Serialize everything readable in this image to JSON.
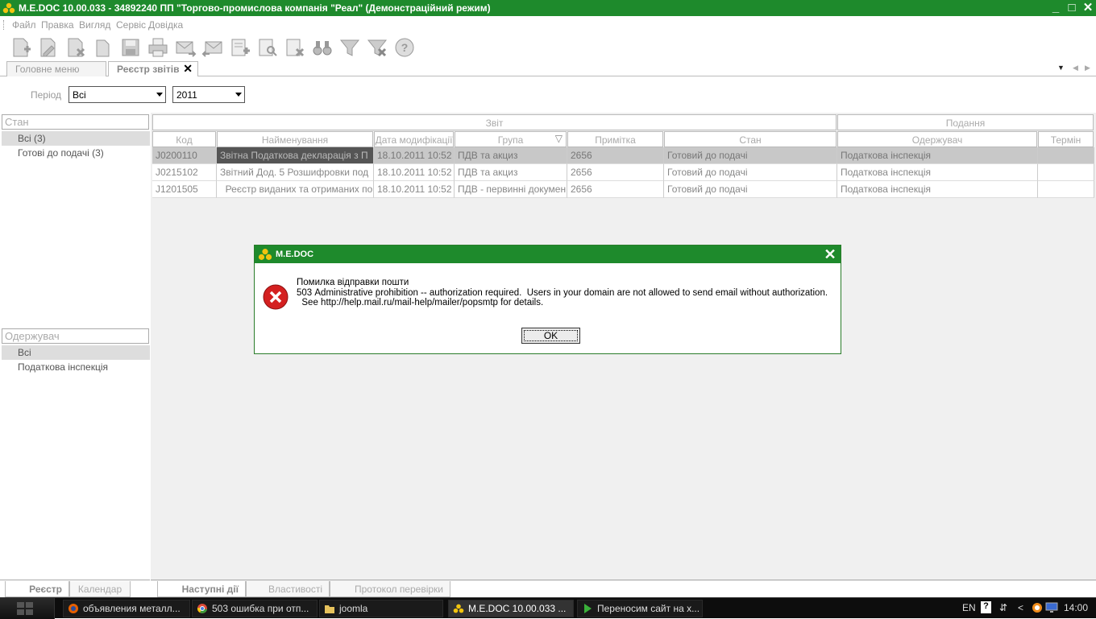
{
  "window": {
    "title": "M.E.DOC 10.00.033  - 34892240 ПП \"Торгово-промислова компанія \"Реал\" (Демонстраційний режим)"
  },
  "menu": [
    "Файл",
    "Правка",
    "Вигляд",
    "Сервіс",
    "Довідка"
  ],
  "toolbar_icons": [
    "new-document-icon",
    "edit-document-icon",
    "delete-document-icon",
    "copy-document-icon",
    "save-icon",
    "print-icon",
    "send-mail-icon",
    "receive-mail-icon",
    "add-row-icon",
    "search-document-icon",
    "delete-row-icon",
    "find-binoculars-icon",
    "filter-icon",
    "clear-filter-icon",
    "help-icon"
  ],
  "tabs": [
    {
      "label": "Головне меню"
    },
    {
      "label": "Реєстр звітів"
    }
  ],
  "period": {
    "label": "Період",
    "value": "Всі",
    "year": "2011"
  },
  "left": {
    "state_header": "Стан",
    "state_items": [
      "Всі (3)",
      "Готові до подачі (3)"
    ],
    "recipient_header": "Одержувач",
    "recipient_items": [
      "Всі",
      "Податкова інспекція"
    ]
  },
  "grid": {
    "group_report": "Звіт",
    "group_submission": "Подання",
    "columns": [
      "Код",
      "Найменування",
      "Дата модифікації",
      "Група",
      "Примітка",
      "Стан",
      "Одержувач",
      "Термін"
    ],
    "rows": [
      [
        "J0200110",
        "Звітна  Податкова декларація з П",
        "18.10.2011 10:52",
        "ПДВ та акциз",
        "2656",
        "Готовий до подачі",
        "Податкова інспекція",
        ""
      ],
      [
        "J0215102",
        "Звітний  Дод. 5 Розшифровки под",
        "18.10.2011 10:52",
        "ПДВ та акциз",
        "2656",
        "Готовий до подачі",
        "Податкова інспекція",
        ""
      ],
      [
        "J1201505",
        "  Реєстр виданих та отриманих по",
        "18.10.2011 10:52",
        "ПДВ - первинні докумен",
        "2656",
        "Готовий до подачі",
        "Податкова інспекція",
        ""
      ]
    ]
  },
  "bottom_tabs_left": [
    "Реєстр",
    "Календар"
  ],
  "bottom_tabs_right": [
    "Наступні дії",
    "Властивості",
    "Протокол перевірки"
  ],
  "dialog": {
    "title": "M.E.DOC",
    "message": "Помилка відправки пошти\n503 Administrative prohibition -- authorization required.  Users in your domain are not allowed to send email without authorization.\n  See http://help.mail.ru/mail-help/mailer/popsmtp for details.",
    "ok": "OK"
  },
  "taskbar": {
    "items": [
      "объявления металл...",
      "503 ошибка при отп...",
      "joomla",
      "M.E.DOC 10.00.033  ...",
      "Переносим сайт на х..."
    ],
    "lang": "EN",
    "clock": "14:00"
  },
  "colors": {
    "titlebar": "#1e8a2c",
    "selection": "#c8c8c8"
  }
}
